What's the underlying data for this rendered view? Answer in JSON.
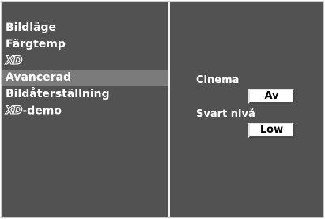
{
  "menu": {
    "items": [
      {
        "label": "Bildläge"
      },
      {
        "label": "Färgtemp"
      },
      {
        "logo": "XD"
      },
      {
        "label": "Avancerad"
      },
      {
        "label": "Bildåterställning"
      },
      {
        "logo": "XD",
        "label": "-demo"
      }
    ],
    "selected": "Avancerad"
  },
  "settings": {
    "cinema": {
      "label": "Cinema",
      "value": "Av"
    },
    "black_level": {
      "label": "Svart nivå",
      "value": "Low"
    }
  }
}
